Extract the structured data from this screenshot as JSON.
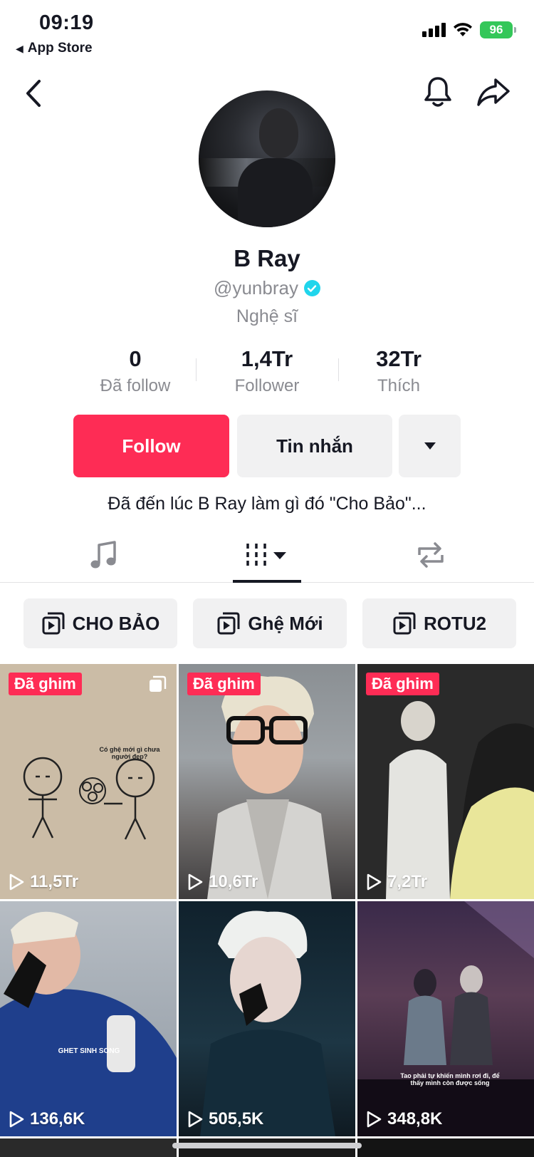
{
  "status_bar": {
    "time": "09:19",
    "back_app": "App Store",
    "battery": "96"
  },
  "profile": {
    "name": "B Ray",
    "handle": "@yunbray",
    "role": "Nghệ sĩ",
    "bio": "Đã đến lúc B Ray làm gì đó \"Cho Bảo\"..."
  },
  "stats": [
    {
      "value": "0",
      "label": "Đã follow"
    },
    {
      "value": "1,4Tr",
      "label": "Follower"
    },
    {
      "value": "32Tr",
      "label": "Thích"
    }
  ],
  "actions": {
    "follow": "Follow",
    "message": "Tin nhắn"
  },
  "playlists": [
    {
      "label": "CHO BẢO"
    },
    {
      "label": "Ghệ Mới"
    },
    {
      "label": "ROTU2"
    }
  ],
  "videos": [
    {
      "views": "11,5Tr",
      "pinned": "Đã ghim",
      "caption": "Có ghệ mới gì chưa người đẹp?"
    },
    {
      "views": "10,6Tr",
      "pinned": "Đã ghim"
    },
    {
      "views": "7,2Tr",
      "pinned": "Đã ghim"
    },
    {
      "views": "136,6K",
      "caption": "GHET SINH SONG"
    },
    {
      "views": "505,5K"
    },
    {
      "views": "348,8K",
      "caption": "Tao phải tự khiến mình rơi đi, để thấy mình còn được sống"
    }
  ],
  "colors": {
    "accent": "#fe2c55",
    "verified": "#20d5ec",
    "battery": "#34c759"
  }
}
